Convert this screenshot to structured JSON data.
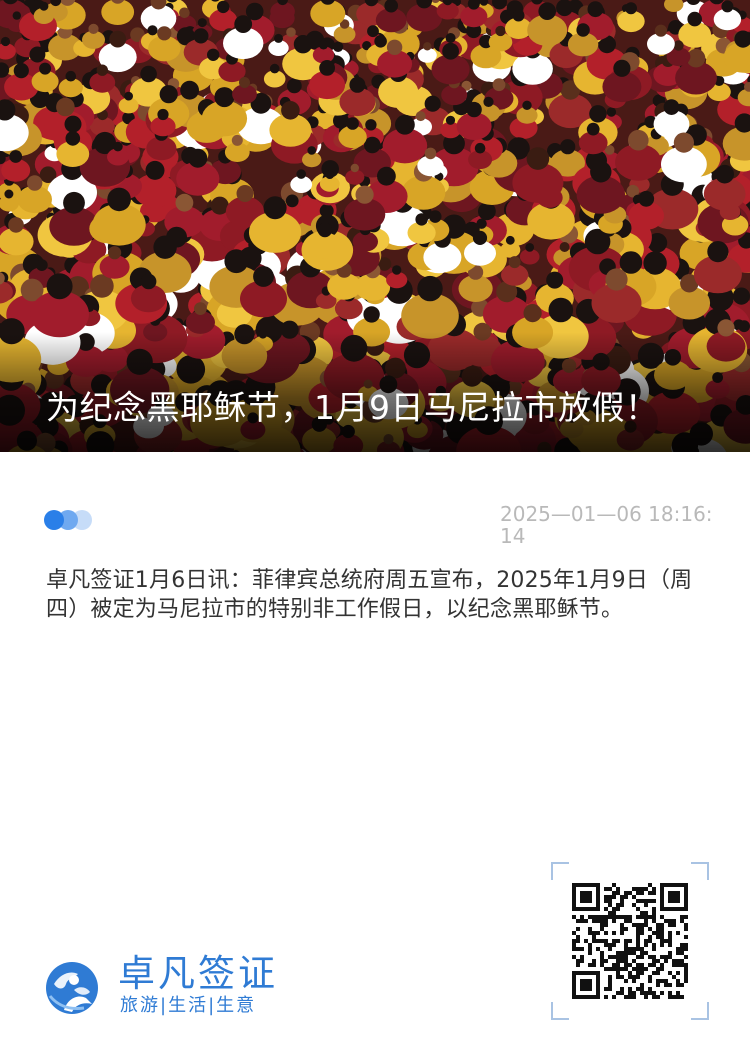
{
  "hero": {
    "title": "为纪念黑耶稣节，1月9日马尼拉市放假！",
    "image_subject": "crowd-photo"
  },
  "meta": {
    "datetime": "2025—01—06  18:16:14"
  },
  "article": {
    "body": "卓凡签证1月6日讯：菲律宾总统府周五宣布，2025年1月9日（周四）被定为马尼拉市的特别非工作假日，以纪念黑耶稣节。"
  },
  "brand": {
    "name": "卓凡签证",
    "slogan": "旅游|生活|生意",
    "logo_icon": "globe-person-icon"
  },
  "qr": {
    "icon": "qr-code-icon"
  },
  "colors": {
    "brand_blue": "#2f7bd4",
    "dot_primary": "#2a7fe8",
    "dot_secondary": "#6fa9f0",
    "dot_tertiary": "#c6dcf8",
    "date_gray": "#b9b9b9",
    "body_text": "#333333",
    "qr_frame": "#a9c3e3"
  }
}
